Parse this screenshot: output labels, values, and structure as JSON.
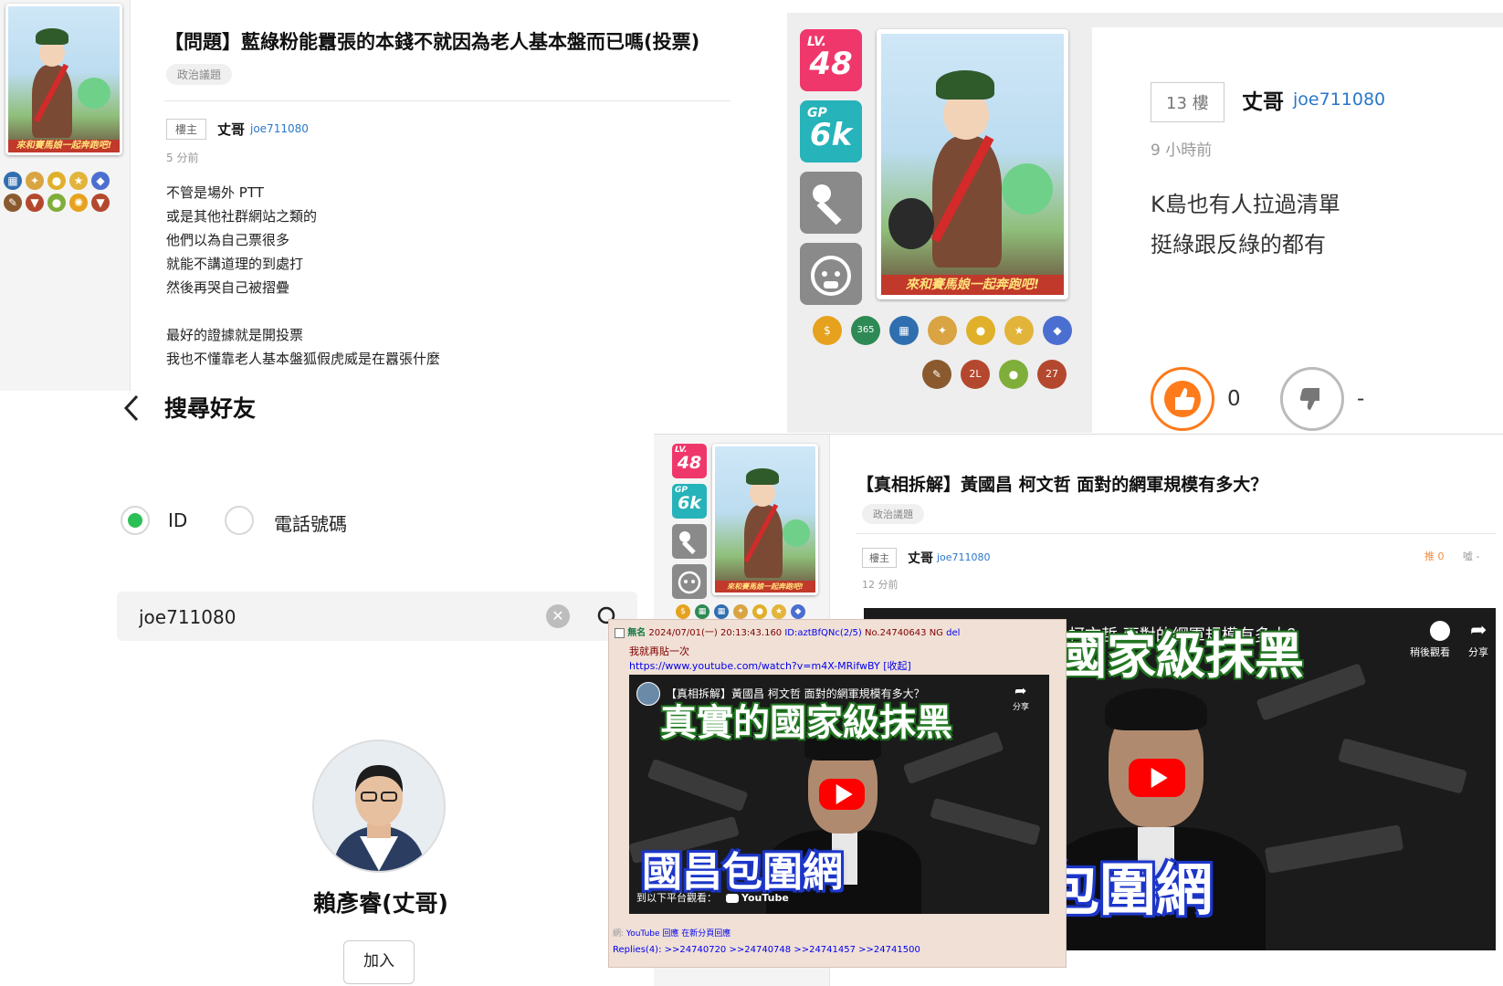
{
  "thread1": {
    "avatar_banner": "來和賽馬娘一起奔跑吧!",
    "title": "【問題】藍綠粉能囂張的本錢不就因為老人基本盤而已嗎(投票)",
    "tag": "政治議題",
    "floor": "樓主",
    "author_name": "丈哥",
    "author_id": "joe711080",
    "time": "5 分前",
    "lines": [
      "不管是場外 PTT",
      "或是其他社群網站之類的",
      "他們以為自己票很多",
      "就能不講道理的到處打",
      "然後再哭自己被摺疊",
      "",
      "最好的證據就是開投票",
      "我也不懂靠老人基本盤狐假虎威是在囂張什麼"
    ]
  },
  "reply": {
    "lv_label": "LV.",
    "lv_value": "48",
    "gp_label": "GP",
    "gp_value": "6k",
    "avatar_banner": "來和賽馬娘一起奔跑吧!",
    "medal_badges": [
      "365",
      "2L",
      "27"
    ],
    "floor": "13 樓",
    "author_name": "丈哥",
    "author_id": "joe711080",
    "time": "9 小時前",
    "lines": [
      "K島也有人拉過清單",
      "挺綠跟反綠的都有"
    ],
    "like_count": "0",
    "dislike_count": "-"
  },
  "friend_search": {
    "title": "搜尋好友",
    "option_id": "ID",
    "option_phone": "電話號碼",
    "search_value": "joe711080",
    "result_name": "賴彥睿(丈哥)",
    "add_button": "加入"
  },
  "thread2": {
    "lv_label": "LV.",
    "lv_value": "48",
    "gp_label": "GP",
    "gp_value": "6k",
    "avatar_banner": "來和賽馬娘一起奔跑吧!",
    "title": "【真相拆解】黃國昌 柯文哲 面對的網軍規模有多大？",
    "tag": "政治議題",
    "floor": "樓主",
    "author_name": "丈哥",
    "author_id": "joe711080",
    "time": "12 分前",
    "push_text": "推 0",
    "boo_text": "噓 -",
    "video_top_text": "柯文哲 面對的網軍規模有多大？",
    "video_headline": "國家級抹黑",
    "video_bottom": "包圍網",
    "video_watch_later": "稍後觀看",
    "video_share": "分享"
  },
  "imageboard": {
    "name": "無名",
    "datetime": "2024/07/01(一) 20:13:43.160",
    "user_id": "ID:aztBfQNc(2/5)",
    "post_no": "No.24740643",
    "ng": "NG",
    "del": "del",
    "body_line": "我就再貼一次",
    "url": "https://www.youtube.com/watch?v=m4X-MRifwBY",
    "collapse": "[收起]",
    "video_title": "【真相拆解】黃國昌 柯文哲 面對的網軍規模有多大？",
    "video_share": "分享",
    "video_headline": "真實的國家級抹黑",
    "video_bottom": "國昌包圍網",
    "watch_on": "到以下平台觀看：",
    "youtube": "YouTube",
    "footer_prefix": "網:",
    "footer_yt": "YouTube 回應",
    "footer_reply": "在新分頁回應",
    "replies_label": "Replies(4):",
    "replies": [
      ">>24740720",
      ">>24740748",
      ">>24741457",
      ">>24741500"
    ]
  },
  "colors": {
    "lv_pink": "#f0376b",
    "gp_teal": "#26b3b9",
    "like_orange": "#ff7a1a",
    "radio_green": "#2bc055",
    "link_blue": "#2a77c9",
    "youtube_red": "#ff0000"
  }
}
